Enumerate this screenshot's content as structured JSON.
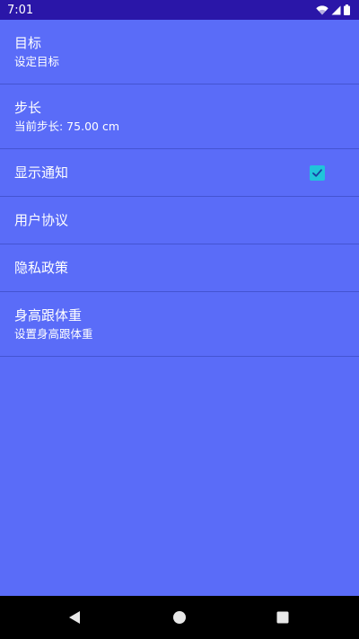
{
  "status_bar": {
    "time": "7:01",
    "icons": [
      "wifi-icon",
      "cell-signal-icon",
      "battery-icon"
    ]
  },
  "settings": {
    "items": [
      {
        "title": "目标",
        "summary": "设定目标"
      },
      {
        "title": "步长",
        "summary": "当前步长: 75.00 cm"
      },
      {
        "title": "显示通知",
        "checked": true
      },
      {
        "title": "用户协议"
      },
      {
        "title": "隐私政策"
      },
      {
        "title": "身高跟体重",
        "summary": "设置身高跟体重"
      }
    ]
  },
  "nav_bar": {
    "buttons": [
      "back-icon",
      "home-icon",
      "recents-icon"
    ]
  },
  "colors": {
    "background": "#5a6cf8",
    "status_bar": "#2a16a8",
    "checkbox": "#20c4da",
    "nav_bar": "#000000"
  }
}
